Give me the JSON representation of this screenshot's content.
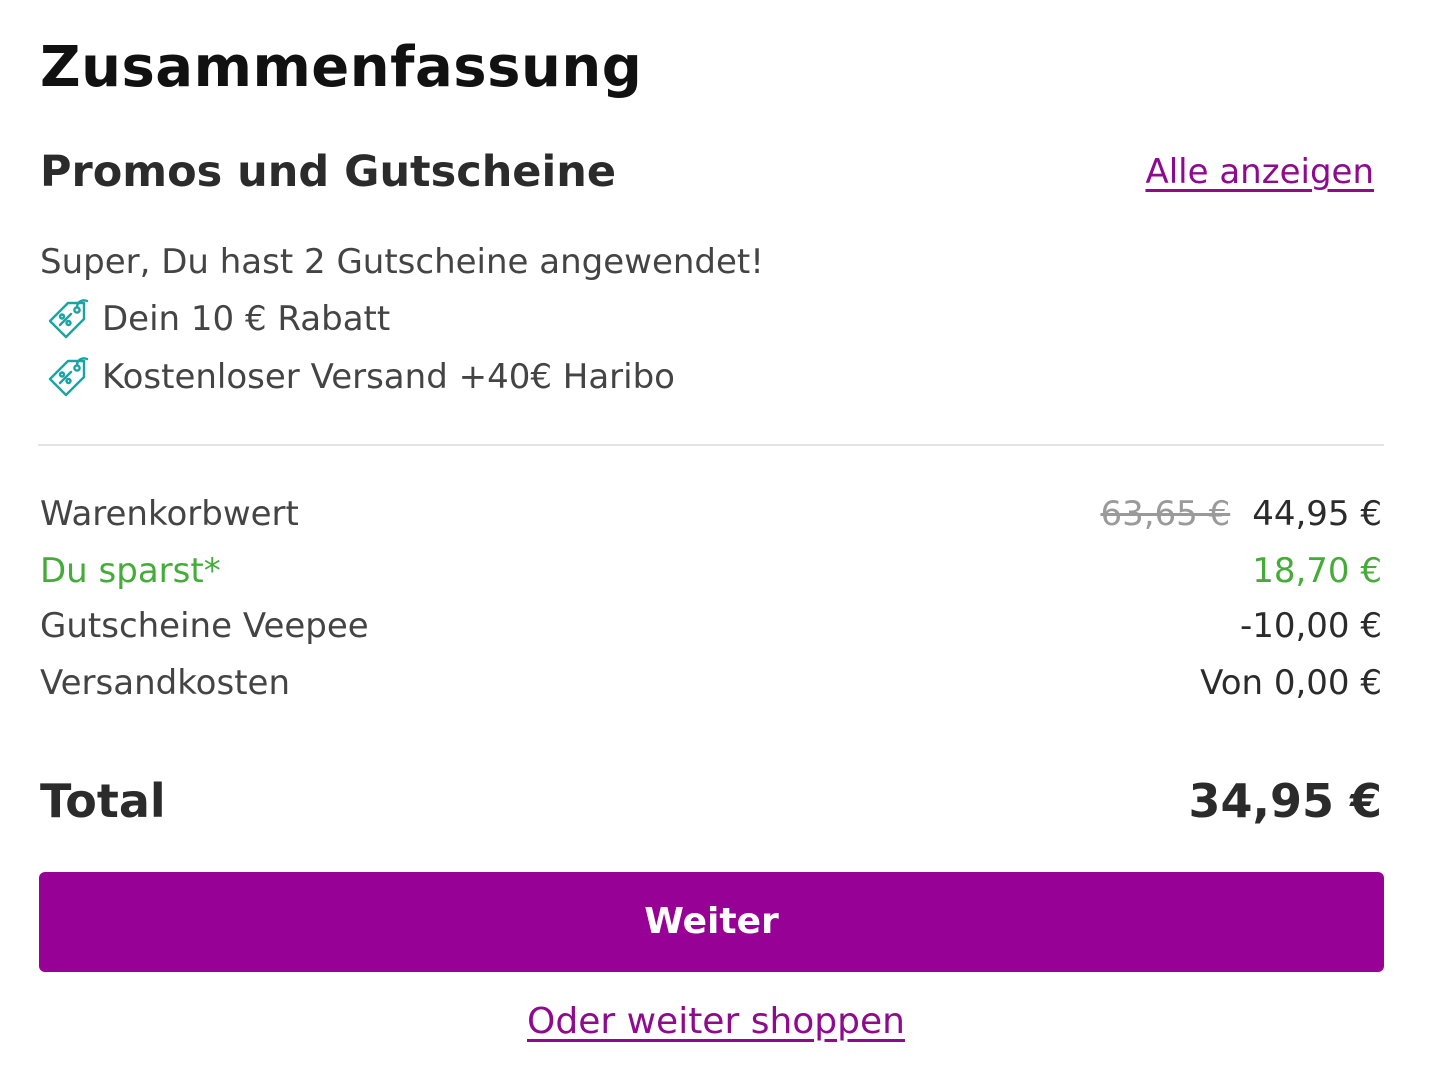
{
  "page": {
    "title": "Zusammenfassung"
  },
  "promos": {
    "heading": "Promos und Gutscheine",
    "show_all_label": "Alle anzeigen",
    "applied_message": "Super, Du hast 2 Gutscheine angewendet!",
    "vouchers": [
      {
        "label": "Dein 10 € Rabatt",
        "icon": "discount-tag-icon"
      },
      {
        "label": "Kostenloser Versand +40€ Haribo",
        "icon": "discount-tag-icon"
      }
    ]
  },
  "summary": {
    "cart_value": {
      "label": "Warenkorbwert",
      "old_price": "63,65 €",
      "price": "44,95 €"
    },
    "savings": {
      "label": "Du sparst*",
      "value": "18,70 €"
    },
    "vouchers_line": {
      "label": "Gutscheine Veepee",
      "value": "-10,00 €"
    },
    "shipping": {
      "label": "Versandkosten",
      "value": "Von 0,00 €"
    }
  },
  "total": {
    "label": "Total",
    "value": "34,95 €"
  },
  "actions": {
    "continue_label": "Weiter",
    "keep_shopping_label": "Oder weiter shoppen"
  },
  "colors": {
    "accent": "#970196",
    "link": "#8e0a8e",
    "savings_green": "#45ac3a",
    "icon_teal": "#1aa3a3"
  }
}
